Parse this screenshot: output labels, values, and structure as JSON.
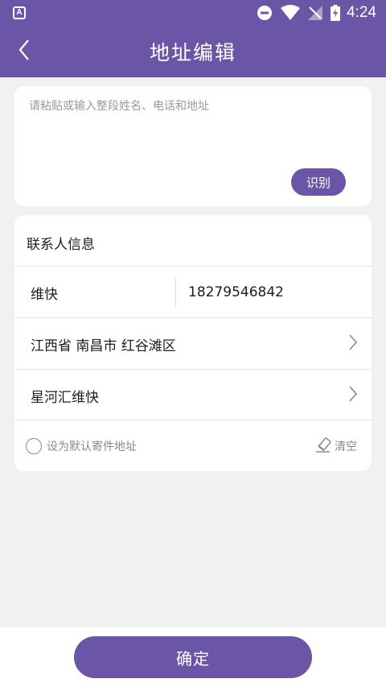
{
  "colors": {
    "primary": "#6a55a6",
    "background": "#f1f1f1",
    "card": "#ffffff",
    "muted_text": "#8a8a8a"
  },
  "status_bar": {
    "time": "4:24",
    "icons": [
      "app-a-icon",
      "do-not-disturb-icon",
      "wifi-icon",
      "no-signal-icon",
      "battery-icon"
    ]
  },
  "title_bar": {
    "title": "地址编辑",
    "back_icon": "back-chevron-icon"
  },
  "paste_card": {
    "placeholder": "请粘贴或输入整段姓名、电话和地址",
    "value": "",
    "recognize_label": "识别"
  },
  "contact_card": {
    "section_title": "联系人信息",
    "name_value": "维快",
    "phone_value": "18279546842",
    "region_value": "江西省 南昌市 红谷滩区",
    "address_value": "星河汇维快",
    "default_label": "设为默认寄件地址",
    "default_checked": false,
    "clear_label": "清空"
  },
  "bottom_bar": {
    "confirm_label": "确定"
  }
}
